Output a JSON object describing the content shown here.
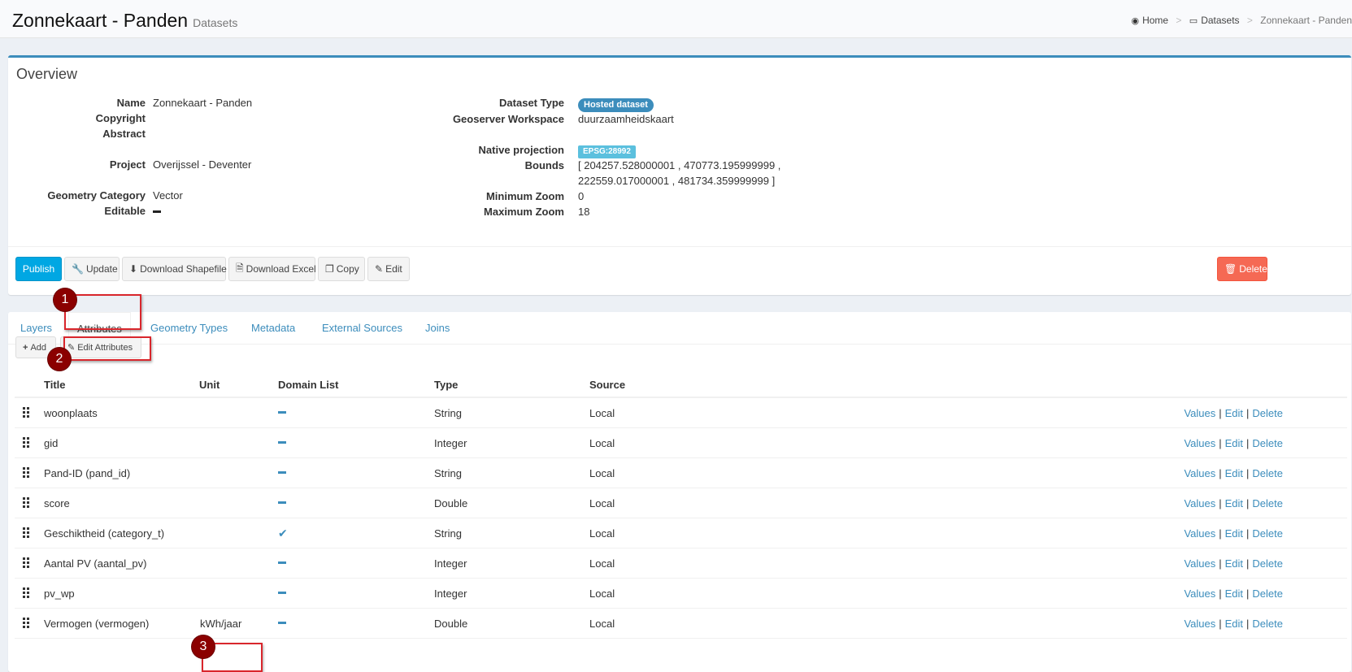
{
  "header": {
    "title": "Zonnekaart - Panden",
    "subtitle": "Datasets",
    "breadcrumb": [
      "Home",
      "Datasets",
      "Zonnekaart - Panden"
    ]
  },
  "overview": {
    "title": "Overview",
    "left": {
      "name_label": "Name",
      "name_value": "Zonnekaart - Panden",
      "copyright_label": "Copyright",
      "abstract_label": "Abstract",
      "project_label": "Project",
      "project_value": "Overijssel - Deventer",
      "geometry_label": "Geometry Category",
      "geometry_value": "Vector",
      "editable_label": "Editable"
    },
    "right": {
      "type_label": "Dataset Type",
      "type_value": "Hosted dataset",
      "workspace_label": "Geoserver Workspace",
      "workspace_value": "duurzaamheidskaart",
      "projection_label": "Native projection",
      "projection_value": "EPSG:28992",
      "bounds_label": "Bounds",
      "bounds_line1": "[ 204257.528000001 , 470773.195999999 ,",
      "bounds_line2": "222559.017000001 , 481734.359999999 ]",
      "minzoom_label": "Minimum Zoom",
      "minzoom_value": "0",
      "maxzoom_label": "Maximum Zoom",
      "maxzoom_value": "18"
    },
    "buttons": {
      "publish": "Publish",
      "update": "Update",
      "download_shapefile": "Download Shapefile",
      "download_excel": "Download Excel",
      "copy": "Copy",
      "edit": "Edit",
      "delete": "Delete"
    }
  },
  "tabs": [
    "Layers",
    "Attributes",
    "Geometry Types",
    "Metadata",
    "External Sources",
    "Joins"
  ],
  "active_tab": "Attributes",
  "toolbar": {
    "add": "Add",
    "edit_attributes": "Edit Attributes"
  },
  "table": {
    "headers": [
      "Title",
      "Unit",
      "Domain List",
      "Type",
      "Source"
    ],
    "action_labels": {
      "values": "Values",
      "edit": "Edit",
      "delete": "Delete",
      "sep": "|"
    },
    "rows": [
      {
        "title": "woonplaats",
        "unit": "",
        "domain": false,
        "type": "String",
        "source": "Local"
      },
      {
        "title": "gid",
        "unit": "",
        "domain": false,
        "type": "Integer",
        "source": "Local"
      },
      {
        "title": "Pand-ID (pand_id)",
        "unit": "",
        "domain": false,
        "type": "String",
        "source": "Local"
      },
      {
        "title": "score",
        "unit": "",
        "domain": false,
        "type": "Double",
        "source": "Local"
      },
      {
        "title": "Geschiktheid (category_t)",
        "unit": "",
        "domain": true,
        "type": "String",
        "source": "Local"
      },
      {
        "title": "Aantal PV (aantal_pv)",
        "unit": "",
        "domain": false,
        "type": "Integer",
        "source": "Local"
      },
      {
        "title": "pv_wp",
        "unit": "",
        "domain": false,
        "type": "Integer",
        "source": "Local"
      },
      {
        "title": "Vermogen (vermogen)",
        "unit": "kWh/jaar",
        "domain": false,
        "type": "Double",
        "source": "Local"
      }
    ]
  },
  "annotations": [
    "1",
    "2",
    "3"
  ],
  "colors": {
    "primary": "#3c8dbc",
    "publish": "#00a7e3",
    "danger": "#f56954",
    "marker": "#8b0000",
    "highlight": "#d9262c"
  }
}
